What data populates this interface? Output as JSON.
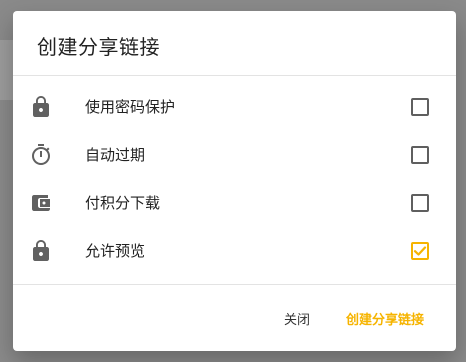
{
  "dialog": {
    "title": "创建分享链接",
    "options": [
      {
        "label": "使用密码保护",
        "icon": "lock-icon",
        "checked": false
      },
      {
        "label": "自动过期",
        "icon": "timer-icon",
        "checked": false
      },
      {
        "label": "付积分下载",
        "icon": "wallet-icon",
        "checked": false
      },
      {
        "label": "允许预览",
        "icon": "lock-icon",
        "checked": true
      }
    ],
    "buttons": {
      "close_label": "关闭",
      "create_label": "创建分享链接"
    }
  },
  "colors": {
    "accent": "#f6b400",
    "overlay": "#7a7a7a",
    "icon": "#616161"
  }
}
